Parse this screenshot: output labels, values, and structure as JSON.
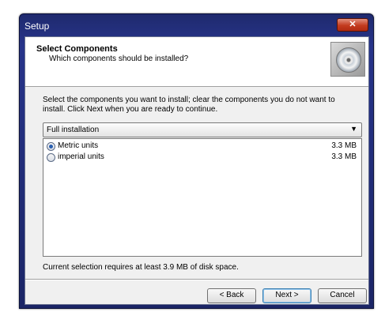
{
  "window": {
    "title": "Setup",
    "close_glyph": "✕"
  },
  "header": {
    "title": "Select Components",
    "subtitle": "Which components should be installed?",
    "icon": "cd-disc-icon"
  },
  "intro_text": "Select the components you want to install; clear the components you do not want to install. Click Next when you are ready to continue.",
  "install_type": {
    "selected": "Full installation",
    "arrow_glyph": "▼"
  },
  "components": [
    {
      "label": "Metric units",
      "size": "3.3 MB",
      "selected": true
    },
    {
      "label": "imperial units",
      "size": "3.3 MB",
      "selected": false
    }
  ],
  "status_text": "Current selection requires at least 3.9 MB of disk space.",
  "buttons": {
    "back": "< Back",
    "next": "Next >",
    "cancel": "Cancel"
  }
}
